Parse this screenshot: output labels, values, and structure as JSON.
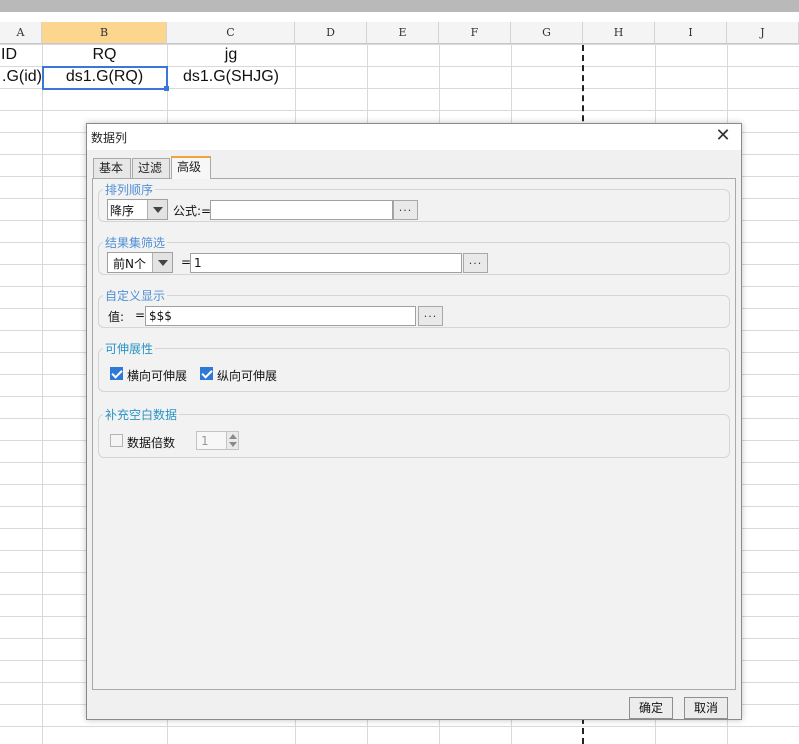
{
  "spreadsheet": {
    "columns": [
      "A",
      "B",
      "C",
      "D",
      "E",
      "F",
      "G",
      "H",
      "I",
      "J"
    ],
    "active_column": "B",
    "row1": {
      "a": "ID",
      "b": "RQ",
      "c": "jg"
    },
    "row2": {
      "a": ".G(id)",
      "b": "ds1.G(RQ)",
      "c": "ds1.G(SHJG)"
    }
  },
  "dialog": {
    "title": "数据列",
    "close_symbol": "✕",
    "tabs": [
      {
        "label": "基本",
        "active": false
      },
      {
        "label": "过滤",
        "active": false
      },
      {
        "label": "高级",
        "active": true
      }
    ],
    "sort": {
      "legend": "排列顺序",
      "order_value": "降序",
      "formula_label": "公式:=",
      "formula_value": "",
      "ellipsis": "..."
    },
    "filter": {
      "legend": "结果集筛选",
      "mode_value": "前N个",
      "equals": "=",
      "value": "1",
      "ellipsis": "..."
    },
    "custom_display": {
      "legend": "自定义显示",
      "value_label": "值:",
      "equals": "=",
      "value": "$$$",
      "ellipsis": "..."
    },
    "expand": {
      "legend": "可伸展性",
      "horizontal_label": "横向可伸展",
      "horizontal_checked": true,
      "vertical_label": "纵向可伸展",
      "vertical_checked": true
    },
    "fill_blank": {
      "legend": "补充空白数据",
      "multiple_label": "数据倍数",
      "multiple_checked": false,
      "multiple_value": "1"
    },
    "buttons": {
      "ok": "确定",
      "cancel": "取消"
    }
  },
  "colors": {
    "active_column_header": "#fcd58f",
    "selection": "#3a77d9",
    "legend_blue": "#4f8fd6",
    "checkbox_checked": "#2f78d6"
  }
}
